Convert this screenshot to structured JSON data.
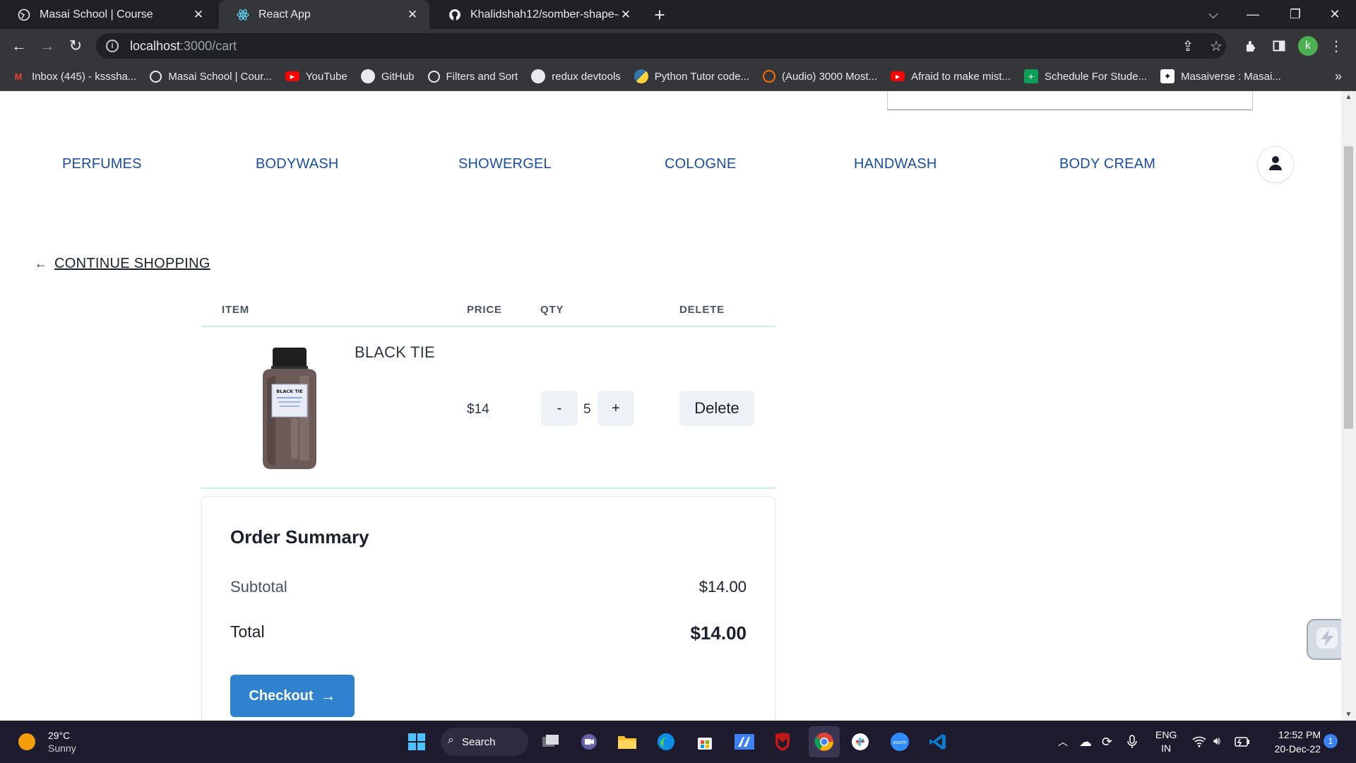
{
  "browser": {
    "tabs": [
      {
        "title": "Masai School | Course",
        "favicon": "globe-icon",
        "active": false
      },
      {
        "title": "React App",
        "favicon": "react-icon",
        "active": true
      },
      {
        "title": "Khalidshah12/somber-shape-478",
        "favicon": "github-icon",
        "active": false
      }
    ],
    "new_tab_symbol": "+",
    "address": {
      "host": "localhost",
      "path": ":3000/cart"
    },
    "profile_initial": "k",
    "bookmarks": [
      {
        "label": "Inbox (445) - ksssha...",
        "icon": "gmail-icon",
        "color": "#ea4335"
      },
      {
        "label": "Masai School | Cour...",
        "icon": "globe-icon",
        "color": "#e8eaed"
      },
      {
        "label": "YouTube",
        "icon": "youtube-icon",
        "color": "#ff0000"
      },
      {
        "label": "GitHub",
        "icon": "github-icon",
        "color": "#e8eaed"
      },
      {
        "label": "Filters and Sort",
        "icon": "globe-icon",
        "color": "#e8eaed"
      },
      {
        "label": "redux devtools",
        "icon": "github-icon",
        "color": "#e8eaed"
      },
      {
        "label": "Python Tutor code...",
        "icon": "python-icon",
        "color": "#ffd43b"
      },
      {
        "label": "(Audio) 3000 Most...",
        "icon": "audio-icon",
        "color": "#ff6d00"
      },
      {
        "label": "Afraid to make mist...",
        "icon": "youtube-icon",
        "color": "#ff0000"
      },
      {
        "label": "Schedule For Stude...",
        "icon": "sheets-icon",
        "color": "#0f9d58"
      },
      {
        "label": "Masaiverse : Masai...",
        "icon": "masai-icon",
        "color": "#ffffff"
      }
    ]
  },
  "nav": {
    "links": [
      "PERFUMES",
      "BODYWASH",
      "SHOWERGEL",
      "COLOGNE",
      "HANDWASH",
      "BODY CREAM"
    ]
  },
  "cart": {
    "continue_label": "CONTINUE SHOPPING",
    "headers": {
      "item": "ITEM",
      "price": "PRICE",
      "qty": "QTY",
      "delete": "DELETE"
    },
    "items": [
      {
        "name": "BLACK TIE",
        "price": "$14",
        "qty": "5",
        "decrement": "-",
        "increment": "+",
        "delete_label": "Delete",
        "image_label": "BLACK TIE"
      }
    ]
  },
  "summary": {
    "title": "Order Summary",
    "subtotal_label": "Subtotal",
    "subtotal_value": "$14.00",
    "total_label": "Total",
    "total_value": "$14.00",
    "checkout_label": "Checkout"
  },
  "taskbar": {
    "weather_temp": "29°C",
    "weather_desc": "Sunny",
    "search_label": "Search",
    "lang_top": "ENG",
    "lang_bottom": "IN",
    "time": "12:52 PM",
    "date": "20-Dec-22",
    "notification_count": "1"
  },
  "colors": {
    "nav_link": "#1a4fa0",
    "checkout_button": "#3182ce",
    "divider": "#c9ecef"
  }
}
